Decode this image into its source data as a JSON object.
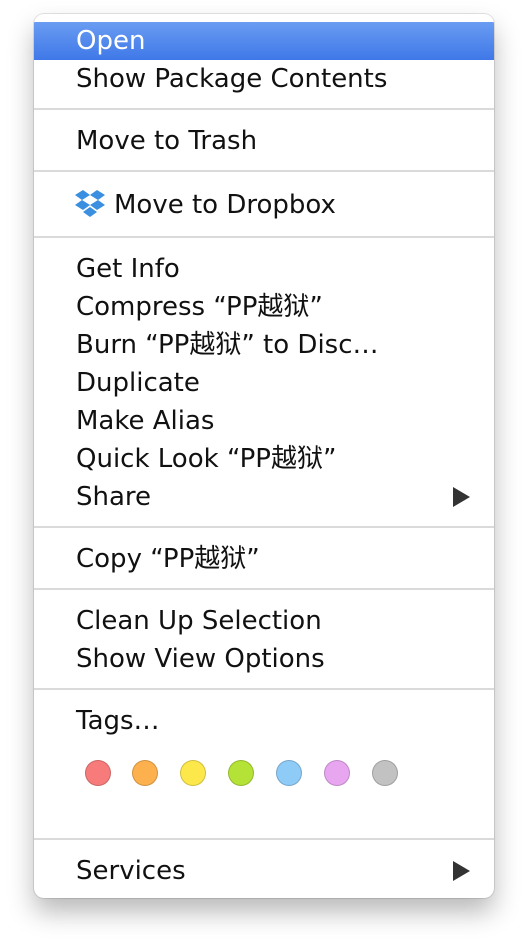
{
  "menu": {
    "items": {
      "open": "Open",
      "show_package_contents": "Show Package Contents",
      "move_to_trash": "Move to Trash",
      "move_to_dropbox": "Move to Dropbox",
      "get_info": "Get Info",
      "compress": "Compress “PP越狱”",
      "burn": "Burn “PP越狱” to Disc…",
      "duplicate": "Duplicate",
      "make_alias": "Make Alias",
      "quick_look": "Quick Look “PP越狱”",
      "share": "Share",
      "copy": "Copy “PP越狱”",
      "clean_up_selection": "Clean Up Selection",
      "show_view_options": "Show View Options",
      "tags": "Tags…",
      "services": "Services"
    },
    "selected_item": "open",
    "selection_color": "#3f78e8",
    "tag_colors": [
      {
        "icon": "red-tag-icon",
        "color": "#f87b7b"
      },
      {
        "icon": "orange-tag-icon",
        "color": "#fdb14e"
      },
      {
        "icon": "yellow-tag-icon",
        "color": "#fde84b"
      },
      {
        "icon": "green-tag-icon",
        "color": "#b4e237"
      },
      {
        "icon": "blue-tag-icon",
        "color": "#8fcbf7"
      },
      {
        "icon": "purple-tag-icon",
        "color": "#e8a6f1"
      },
      {
        "icon": "gray-tag-icon",
        "color": "#c2c2c2"
      }
    ],
    "icons": {
      "dropbox": "dropbox-icon",
      "submenu": "submenu-arrow-icon"
    }
  }
}
